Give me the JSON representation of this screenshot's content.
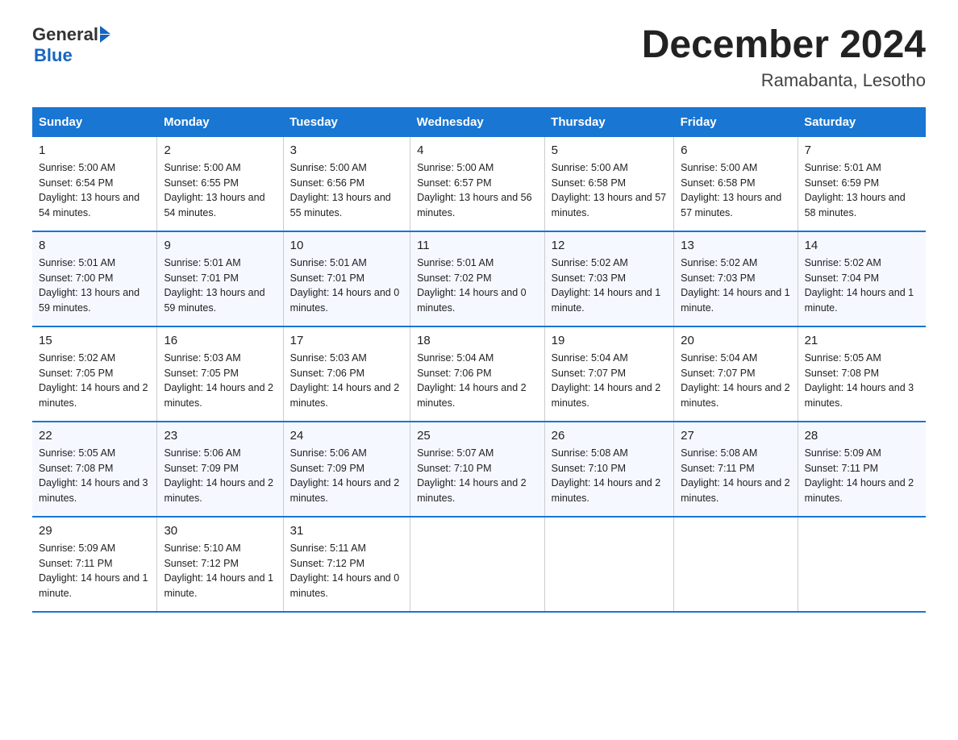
{
  "header": {
    "logo_general": "General",
    "logo_blue": "Blue",
    "title": "December 2024",
    "subtitle": "Ramabanta, Lesotho"
  },
  "days_of_week": [
    "Sunday",
    "Monday",
    "Tuesday",
    "Wednesday",
    "Thursday",
    "Friday",
    "Saturday"
  ],
  "weeks": [
    [
      {
        "day": 1,
        "sunrise": "5:00 AM",
        "sunset": "6:54 PM",
        "daylight": "13 hours and 54 minutes."
      },
      {
        "day": 2,
        "sunrise": "5:00 AM",
        "sunset": "6:55 PM",
        "daylight": "13 hours and 54 minutes."
      },
      {
        "day": 3,
        "sunrise": "5:00 AM",
        "sunset": "6:56 PM",
        "daylight": "13 hours and 55 minutes."
      },
      {
        "day": 4,
        "sunrise": "5:00 AM",
        "sunset": "6:57 PM",
        "daylight": "13 hours and 56 minutes."
      },
      {
        "day": 5,
        "sunrise": "5:00 AM",
        "sunset": "6:58 PM",
        "daylight": "13 hours and 57 minutes."
      },
      {
        "day": 6,
        "sunrise": "5:00 AM",
        "sunset": "6:58 PM",
        "daylight": "13 hours and 57 minutes."
      },
      {
        "day": 7,
        "sunrise": "5:01 AM",
        "sunset": "6:59 PM",
        "daylight": "13 hours and 58 minutes."
      }
    ],
    [
      {
        "day": 8,
        "sunrise": "5:01 AM",
        "sunset": "7:00 PM",
        "daylight": "13 hours and 59 minutes."
      },
      {
        "day": 9,
        "sunrise": "5:01 AM",
        "sunset": "7:01 PM",
        "daylight": "13 hours and 59 minutes."
      },
      {
        "day": 10,
        "sunrise": "5:01 AM",
        "sunset": "7:01 PM",
        "daylight": "14 hours and 0 minutes."
      },
      {
        "day": 11,
        "sunrise": "5:01 AM",
        "sunset": "7:02 PM",
        "daylight": "14 hours and 0 minutes."
      },
      {
        "day": 12,
        "sunrise": "5:02 AM",
        "sunset": "7:03 PM",
        "daylight": "14 hours and 1 minute."
      },
      {
        "day": 13,
        "sunrise": "5:02 AM",
        "sunset": "7:03 PM",
        "daylight": "14 hours and 1 minute."
      },
      {
        "day": 14,
        "sunrise": "5:02 AM",
        "sunset": "7:04 PM",
        "daylight": "14 hours and 1 minute."
      }
    ],
    [
      {
        "day": 15,
        "sunrise": "5:02 AM",
        "sunset": "7:05 PM",
        "daylight": "14 hours and 2 minutes."
      },
      {
        "day": 16,
        "sunrise": "5:03 AM",
        "sunset": "7:05 PM",
        "daylight": "14 hours and 2 minutes."
      },
      {
        "day": 17,
        "sunrise": "5:03 AM",
        "sunset": "7:06 PM",
        "daylight": "14 hours and 2 minutes."
      },
      {
        "day": 18,
        "sunrise": "5:04 AM",
        "sunset": "7:06 PM",
        "daylight": "14 hours and 2 minutes."
      },
      {
        "day": 19,
        "sunrise": "5:04 AM",
        "sunset": "7:07 PM",
        "daylight": "14 hours and 2 minutes."
      },
      {
        "day": 20,
        "sunrise": "5:04 AM",
        "sunset": "7:07 PM",
        "daylight": "14 hours and 2 minutes."
      },
      {
        "day": 21,
        "sunrise": "5:05 AM",
        "sunset": "7:08 PM",
        "daylight": "14 hours and 3 minutes."
      }
    ],
    [
      {
        "day": 22,
        "sunrise": "5:05 AM",
        "sunset": "7:08 PM",
        "daylight": "14 hours and 3 minutes."
      },
      {
        "day": 23,
        "sunrise": "5:06 AM",
        "sunset": "7:09 PM",
        "daylight": "14 hours and 2 minutes."
      },
      {
        "day": 24,
        "sunrise": "5:06 AM",
        "sunset": "7:09 PM",
        "daylight": "14 hours and 2 minutes."
      },
      {
        "day": 25,
        "sunrise": "5:07 AM",
        "sunset": "7:10 PM",
        "daylight": "14 hours and 2 minutes."
      },
      {
        "day": 26,
        "sunrise": "5:08 AM",
        "sunset": "7:10 PM",
        "daylight": "14 hours and 2 minutes."
      },
      {
        "day": 27,
        "sunrise": "5:08 AM",
        "sunset": "7:11 PM",
        "daylight": "14 hours and 2 minutes."
      },
      {
        "day": 28,
        "sunrise": "5:09 AM",
        "sunset": "7:11 PM",
        "daylight": "14 hours and 2 minutes."
      }
    ],
    [
      {
        "day": 29,
        "sunrise": "5:09 AM",
        "sunset": "7:11 PM",
        "daylight": "14 hours and 1 minute."
      },
      {
        "day": 30,
        "sunrise": "5:10 AM",
        "sunset": "7:12 PM",
        "daylight": "14 hours and 1 minute."
      },
      {
        "day": 31,
        "sunrise": "5:11 AM",
        "sunset": "7:12 PM",
        "daylight": "14 hours and 0 minutes."
      },
      null,
      null,
      null,
      null
    ]
  ],
  "labels": {
    "sunrise": "Sunrise:",
    "sunset": "Sunset:",
    "daylight": "Daylight:"
  }
}
